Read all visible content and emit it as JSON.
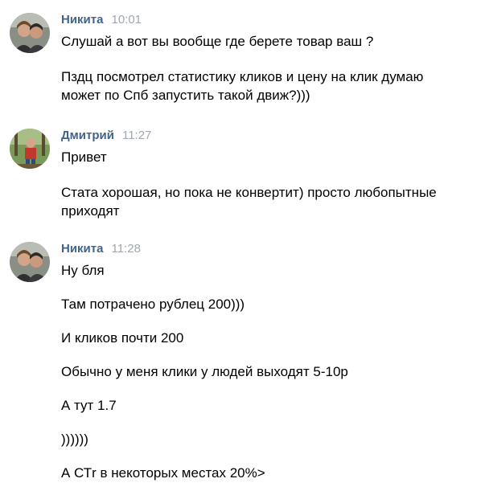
{
  "messages": [
    {
      "author": "Никита",
      "time": "10:01",
      "avatar_icon": "user-avatar-photo",
      "lines": [
        "Слушай а вот вы вообще где берете товар ваш ?",
        "Пздц посмотрел статистику кликов и цену на клик думаю",
        "может по Спб запустить такой движ?)))"
      ]
    },
    {
      "author": "Дмитрий",
      "time": "11:27",
      "avatar_icon": "user-avatar-photo",
      "lines": [
        "Привет",
        "Стата хорошая, но пока не конвертит) просто любопытные",
        "приходят"
      ]
    },
    {
      "author": "Никита",
      "time": "11:28",
      "avatar_icon": "user-avatar-photo",
      "lines": [
        "Ну бля",
        "Там потрачено рублец 200)))",
        "И кликов почти 200",
        "Обычно у меня клики у людей выходят 5-10р",
        "А тут 1.7",
        "))))))",
        "А СТr в некоторых местах 20%>"
      ]
    }
  ],
  "colors": {
    "author": "#42648b",
    "time": "#a0a7b0",
    "text": "#000000"
  }
}
